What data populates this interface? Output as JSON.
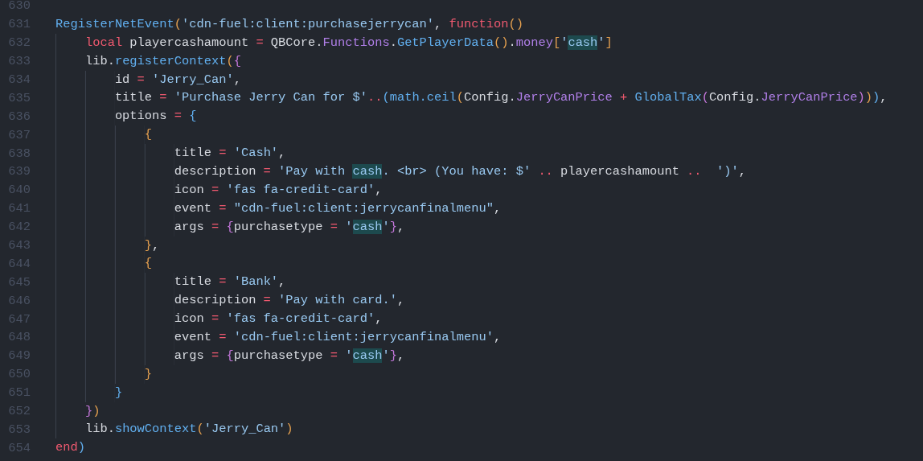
{
  "editor": {
    "lines": [
      {
        "number": "630"
      },
      {
        "number": "631",
        "tokens": [
          {
            "kind": "fn",
            "text": "RegisterNetEvent"
          },
          {
            "kind": "b1",
            "text": "("
          },
          {
            "kind": "str",
            "text": "'cdn-fuel:client:purchasejerrycan'"
          },
          {
            "kind": "plain",
            "text": ","
          },
          {
            "kind": "kw",
            "text": " function"
          },
          {
            "kind": "b1",
            "text": "()"
          }
        ]
      },
      {
        "number": "632",
        "tokens": [
          {
            "kind": "kw",
            "text": "    local"
          },
          {
            "kind": "plain",
            "text": " playercashamount"
          },
          {
            "kind": "op",
            "text": " ="
          },
          {
            "kind": "plain",
            "text": " QBCore."
          },
          {
            "kind": "prop",
            "text": "Functions"
          },
          {
            "kind": "plain",
            "text": "."
          },
          {
            "kind": "fn",
            "text": "GetPlayerData"
          },
          {
            "kind": "b1",
            "text": "()"
          },
          {
            "kind": "plain",
            "text": "."
          },
          {
            "kind": "prop",
            "text": "money"
          },
          {
            "kind": "b1",
            "text": "["
          },
          {
            "kind": "str",
            "text": "'"
          },
          {
            "kind": "match",
            "text": "cash"
          },
          {
            "kind": "str",
            "text": "'"
          },
          {
            "kind": "b1",
            "text": "]"
          }
        ]
      },
      {
        "number": "633",
        "tokens": [
          {
            "kind": "plain",
            "text": "    lib."
          },
          {
            "kind": "fn",
            "text": "registerContext"
          },
          {
            "kind": "b1",
            "text": "("
          },
          {
            "kind": "b2",
            "text": "{"
          }
        ]
      },
      {
        "number": "634",
        "tokens": [
          {
            "kind": "plain",
            "text": "        id"
          },
          {
            "kind": "op",
            "text": " ="
          },
          {
            "kind": "str",
            "text": " 'Jerry_Can'"
          },
          {
            "kind": "plain",
            "text": ","
          }
        ]
      },
      {
        "number": "635",
        "tokens": [
          {
            "kind": "plain",
            "text": "        title"
          },
          {
            "kind": "op",
            "text": " ="
          },
          {
            "kind": "str",
            "text": " 'Purchase Jerry Can for $'"
          },
          {
            "kind": "op",
            "text": ".."
          },
          {
            "kind": "b3",
            "text": "("
          },
          {
            "kind": "fn",
            "text": "math.ceil"
          },
          {
            "kind": "b1",
            "text": "("
          },
          {
            "kind": "plain",
            "text": "Config."
          },
          {
            "kind": "prop",
            "text": "JerryCanPrice"
          },
          {
            "kind": "op",
            "text": " +"
          },
          {
            "kind": "fn",
            "text": " GlobalTax"
          },
          {
            "kind": "b2",
            "text": "("
          },
          {
            "kind": "plain",
            "text": "Config."
          },
          {
            "kind": "prop",
            "text": "JerryCanPrice"
          },
          {
            "kind": "b2",
            "text": ")"
          },
          {
            "kind": "b1",
            "text": ")"
          },
          {
            "kind": "b3",
            "text": ")"
          },
          {
            "kind": "plain",
            "text": ","
          }
        ]
      },
      {
        "number": "636",
        "tokens": [
          {
            "kind": "plain",
            "text": "        options"
          },
          {
            "kind": "op",
            "text": " ="
          },
          {
            "kind": "b3",
            "text": " {"
          }
        ]
      },
      {
        "number": "637",
        "tokens": [
          {
            "kind": "b1",
            "text": "            {"
          }
        ]
      },
      {
        "number": "638",
        "tokens": [
          {
            "kind": "plain",
            "text": "                title"
          },
          {
            "kind": "op",
            "text": " ="
          },
          {
            "kind": "str",
            "text": " 'Cash'"
          },
          {
            "kind": "plain",
            "text": ","
          }
        ]
      },
      {
        "number": "639",
        "tokens": [
          {
            "kind": "plain",
            "text": "                description"
          },
          {
            "kind": "op",
            "text": " ="
          },
          {
            "kind": "str",
            "text": " 'Pay with "
          },
          {
            "kind": "match",
            "text": "cash"
          },
          {
            "kind": "str",
            "text": ". <br> (You have: $'"
          },
          {
            "kind": "op",
            "text": " .."
          },
          {
            "kind": "plain",
            "text": " playercashamount"
          },
          {
            "kind": "op",
            "text": " .."
          },
          {
            "kind": "str",
            "text": "  ')'"
          },
          {
            "kind": "plain",
            "text": ","
          }
        ]
      },
      {
        "number": "640",
        "tokens": [
          {
            "kind": "plain",
            "text": "                icon"
          },
          {
            "kind": "op",
            "text": " ="
          },
          {
            "kind": "str",
            "text": " 'fas fa-credit-card'"
          },
          {
            "kind": "plain",
            "text": ","
          }
        ]
      },
      {
        "number": "641",
        "tokens": [
          {
            "kind": "plain",
            "text": "                event"
          },
          {
            "kind": "op",
            "text": " ="
          },
          {
            "kind": "str",
            "text": " \"cdn-fuel:client:jerrycanfinalmenu\""
          },
          {
            "kind": "plain",
            "text": ","
          }
        ]
      },
      {
        "number": "642",
        "tokens": [
          {
            "kind": "plain",
            "text": "                args"
          },
          {
            "kind": "op",
            "text": " ="
          },
          {
            "kind": "b2",
            "text": " {"
          },
          {
            "kind": "plain",
            "text": "purchasetype"
          },
          {
            "kind": "op",
            "text": " ="
          },
          {
            "kind": "str",
            "text": " '"
          },
          {
            "kind": "match",
            "text": "cash"
          },
          {
            "kind": "str",
            "text": "'"
          },
          {
            "kind": "b2",
            "text": "}"
          },
          {
            "kind": "plain",
            "text": ","
          }
        ]
      },
      {
        "number": "643",
        "tokens": [
          {
            "kind": "b1",
            "text": "            }"
          },
          {
            "kind": "plain",
            "text": ","
          }
        ]
      },
      {
        "number": "644",
        "tokens": [
          {
            "kind": "b1",
            "text": "            {"
          }
        ]
      },
      {
        "number": "645",
        "tokens": [
          {
            "kind": "plain",
            "text": "                title"
          },
          {
            "kind": "op",
            "text": " ="
          },
          {
            "kind": "str",
            "text": " 'Bank'"
          },
          {
            "kind": "plain",
            "text": ","
          }
        ]
      },
      {
        "number": "646",
        "tokens": [
          {
            "kind": "plain",
            "text": "                description"
          },
          {
            "kind": "op",
            "text": " ="
          },
          {
            "kind": "str",
            "text": " 'Pay with card.'"
          },
          {
            "kind": "plain",
            "text": ","
          }
        ]
      },
      {
        "number": "647",
        "tokens": [
          {
            "kind": "plain",
            "text": "                icon"
          },
          {
            "kind": "op",
            "text": " ="
          },
          {
            "kind": "str",
            "text": " 'fas fa-credit-card'"
          },
          {
            "kind": "plain",
            "text": ","
          }
        ]
      },
      {
        "number": "648",
        "tokens": [
          {
            "kind": "plain",
            "text": "                event"
          },
          {
            "kind": "op",
            "text": " ="
          },
          {
            "kind": "str",
            "text": " 'cdn-fuel:client:jerrycanfinalmenu'"
          },
          {
            "kind": "plain",
            "text": ","
          }
        ]
      },
      {
        "number": "649",
        "tokens": [
          {
            "kind": "plain",
            "text": "                args"
          },
          {
            "kind": "op",
            "text": " ="
          },
          {
            "kind": "b2",
            "text": " {"
          },
          {
            "kind": "plain",
            "text": "purchasetype"
          },
          {
            "kind": "op",
            "text": " ="
          },
          {
            "kind": "str",
            "text": " '"
          },
          {
            "kind": "match",
            "text": "cash"
          },
          {
            "kind": "str",
            "text": "'"
          },
          {
            "kind": "b2",
            "text": "}"
          },
          {
            "kind": "plain",
            "text": ","
          }
        ]
      },
      {
        "number": "650",
        "tokens": [
          {
            "kind": "b1",
            "text": "            }"
          }
        ]
      },
      {
        "number": "651",
        "tokens": [
          {
            "kind": "b3",
            "text": "        }"
          }
        ]
      },
      {
        "number": "652",
        "tokens": [
          {
            "kind": "b2",
            "text": "    }"
          },
          {
            "kind": "b1",
            "text": ")"
          }
        ]
      },
      {
        "number": "653",
        "tokens": [
          {
            "kind": "plain",
            "text": "    lib."
          },
          {
            "kind": "fn",
            "text": "showContext"
          },
          {
            "kind": "b1",
            "text": "("
          },
          {
            "kind": "str",
            "text": "'Jerry_Can'"
          },
          {
            "kind": "b1",
            "text": ")"
          }
        ]
      },
      {
        "number": "654",
        "tokens": [
          {
            "kind": "kw",
            "text": "end"
          },
          {
            "kind": "b3",
            "text": ")"
          }
        ]
      }
    ]
  }
}
